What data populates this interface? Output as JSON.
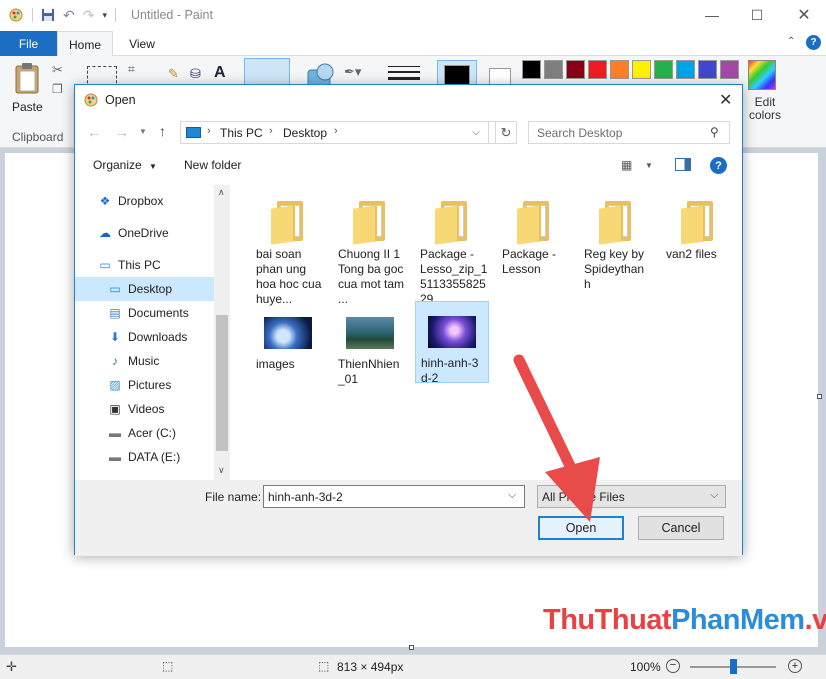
{
  "app": {
    "title": "Untitled - Paint",
    "tabs": {
      "file": "File",
      "home": "Home",
      "view": "View"
    },
    "ribbon": {
      "paste_label": "Paste",
      "clipboard_label": "Clipboard",
      "edit_colors_label": "Edit colors",
      "palette": [
        "#000000",
        "#7f7f7f",
        "#880015",
        "#ed1c24",
        "#ff7f27",
        "#fff200",
        "#22b14c",
        "#00a2e8",
        "#3f48cc",
        "#a349a4"
      ]
    },
    "status": {
      "canvas_size": "813 × 494px",
      "zoom": "100%"
    }
  },
  "dialog": {
    "title": "Open",
    "breadcrumb": [
      "This PC",
      "Desktop"
    ],
    "search_placeholder": "Search Desktop",
    "toolbar": {
      "organize": "Organize",
      "new_folder": "New folder"
    },
    "nav_items": [
      {
        "label": "Dropbox",
        "icon": "dropbox-icon"
      },
      {
        "label": "OneDrive",
        "icon": "onedrive-icon"
      },
      {
        "label": "This PC",
        "icon": "computer-icon"
      },
      {
        "label": "Desktop",
        "icon": "desktop-icon",
        "selected": true
      },
      {
        "label": "Documents",
        "icon": "documents-icon"
      },
      {
        "label": "Downloads",
        "icon": "downloads-icon"
      },
      {
        "label": "Music",
        "icon": "music-icon"
      },
      {
        "label": "Pictures",
        "icon": "pictures-icon"
      },
      {
        "label": "Videos",
        "icon": "videos-icon"
      },
      {
        "label": "Acer (C:)",
        "icon": "drive-icon"
      },
      {
        "label": "DATA (E:)",
        "icon": "drive-icon"
      }
    ],
    "files": [
      {
        "name": "bai soan phan ung hoa hoc cua huye...",
        "kind": "folder"
      },
      {
        "name": "Chuong II 1 Tong ba goc cua mot tam ...",
        "kind": "folder"
      },
      {
        "name": "Package - Lesso_zip_15113355825 29",
        "kind": "folder"
      },
      {
        "name": "Package - Lesson",
        "kind": "folder"
      },
      {
        "name": "Reg key by Spideythan h",
        "kind": "folder"
      },
      {
        "name": "van2 files",
        "kind": "folder"
      },
      {
        "name": "images",
        "kind": "image"
      },
      {
        "name": "ThienNhien _01",
        "kind": "image"
      },
      {
        "name": "hinh-anh-3 d-2",
        "kind": "image",
        "selected": true
      }
    ],
    "filename_label": "File name:",
    "filename_value": "hinh-anh-3d-2",
    "filetype_value": "All Picture Files",
    "open_button": "Open",
    "cancel_button": "Cancel"
  },
  "watermark": {
    "part1": "ThuThuat",
    "part2": "PhanMem",
    "part3": ".vn"
  },
  "colors": {
    "accent": "#1c6dc4",
    "selection": "#cce8ff",
    "arrow": "#e94b4b"
  }
}
